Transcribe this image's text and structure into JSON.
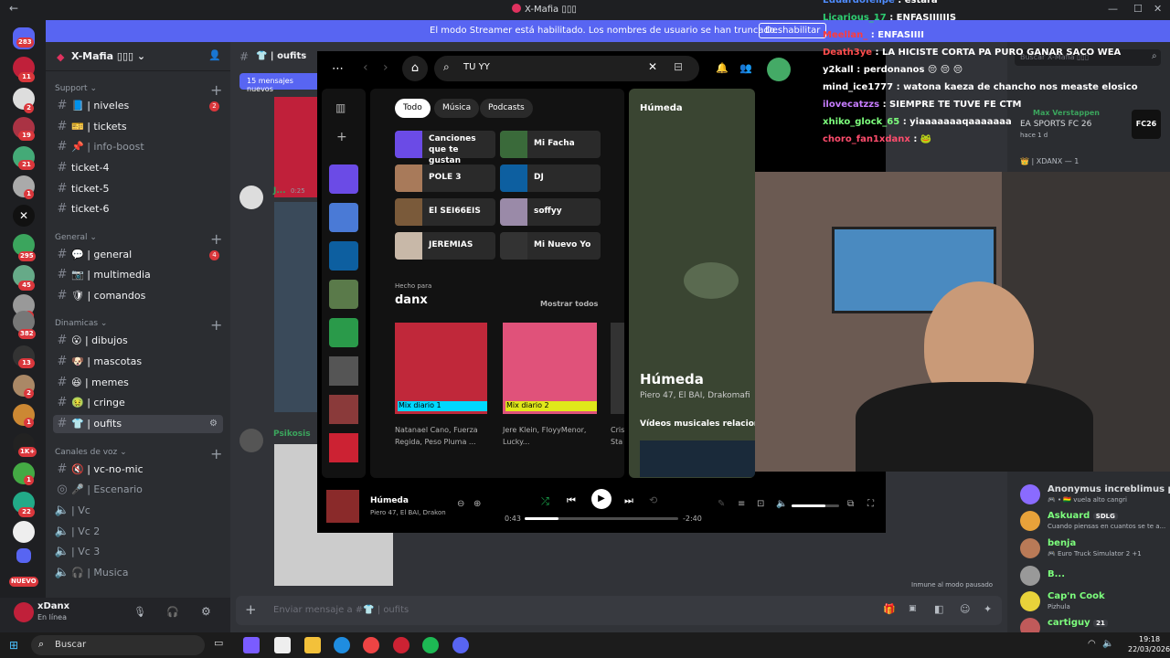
{
  "window": {
    "title": "X-Mafia ▯▯▯",
    "back": "←"
  },
  "banner": {
    "text": "El modo Streamer está habilitado. Los nombres de usuario se han truncado.",
    "button": "Deshabilitar"
  },
  "guilds": {
    "badges": [
      "283",
      "11",
      "2",
      "19",
      "21",
      "1",
      "295",
      "45",
      "1",
      "382",
      "13",
      "2",
      "1",
      "1K+",
      "1",
      "22",
      "NUEVO"
    ]
  },
  "server": {
    "name": "X-Mafia ▯▯▯ ⌄"
  },
  "categories": {
    "support": "Support ⌄",
    "general": "General ⌄",
    "dinamicas": "Dinamicas ⌄",
    "voz": "Canales de voz ⌄"
  },
  "channels": [
    {
      "label": "📘 | niveles",
      "badge": "2"
    },
    {
      "label": "🎫 | tickets",
      "badge": ""
    },
    {
      "label": "📌 | info-boost",
      "badge": ""
    },
    {
      "label": "ticket-4",
      "badge": ""
    },
    {
      "label": "ticket-5",
      "badge": ""
    },
    {
      "label": "ticket-6",
      "badge": ""
    },
    {
      "label": "💬 | general",
      "badge": "4"
    },
    {
      "label": "📷 | multimedia",
      "badge": ""
    },
    {
      "label": "🛡 | comandos",
      "badge": ""
    },
    {
      "label": "😮 | dibujos",
      "badge": ""
    },
    {
      "label": "🐶 | mascotas",
      "badge": ""
    },
    {
      "label": "😆 | memes",
      "badge": ""
    },
    {
      "label": "🤢 | cringe",
      "badge": ""
    },
    {
      "label": "👕 | oufits",
      "badge": ""
    }
  ],
  "voice": [
    "🔇 | vc-no-mic",
    "🎤 | Escenario",
    "| Vc",
    "| Vc 2",
    "| Vc 3",
    "🎧 | Musica"
  ],
  "user": {
    "name": "xDanx",
    "status": "En línea"
  },
  "chat": {
    "channel": "👕 | oufits",
    "new_messages": "15 mensajes nuevos",
    "msg_author1": "J...",
    "msg_time1": "0:25",
    "msg_author2": "Psikosis",
    "input_placeholder": "Enviar mensaje a #👕 | oufits",
    "paused": "Inmune al modo pausado"
  },
  "spotify": {
    "search": "TU YY",
    "chips": [
      "Todo",
      "Música",
      "Podcasts"
    ],
    "cards": [
      "Canciones que te gustan",
      "Mi Facha",
      "POLE 3",
      "DJ",
      "El SEI66EIS",
      "soffyy",
      "JEREMIAS",
      "Mi Nuevo Yo"
    ],
    "made_for": "Hecho para",
    "made_for_user": "danx",
    "show_all": "Mostrar todos",
    "mixes": [
      {
        "label": "Mix diario 1",
        "artists": "Natanael Cano, Fuerza Regida, Peso Pluma ..."
      },
      {
        "label": "Mix diario 2",
        "artists": "Jere Klein, FloyyMenor, Lucky..."
      }
    ],
    "mix3_artists": "Cris Sta",
    "now_header": "Húmeda",
    "now_title": "Húmeda",
    "now_artists": "Piero 47, El BAI, Drakomafi",
    "videos": "Vídeos musicales relacion",
    "bar_title": "Húmeda",
    "bar_artists": "Piero 47, El BAI, Drakon",
    "elapsed": "0:43",
    "remaining": "-2:40",
    "progress": 0.22,
    "volume": 0.72
  },
  "twitch_chat": [
    {
      "user": "Eduardofelipe",
      "msg": ": estara",
      "color": "#4f8cff"
    },
    {
      "user": "Licarious_17",
      "msg": ": ENFASIIIIIIS",
      "color": "#2ecc71"
    },
    {
      "user": "Meellan_",
      "msg": ": ENFASIIII",
      "color": "#ff3b3b"
    },
    {
      "user": "Death3ye",
      "msg": ": LA HICISTE CORTA PA PURO GANAR SACO WEA",
      "color": "#ff4d4d"
    },
    {
      "user": "y2kall",
      "msg": ": perdonanos 😔 😔 😔",
      "color": "#ffffff"
    },
    {
      "user": "mind_ice1777",
      "msg": ": watona kaeza de chancho nos measte elosico",
      "color": "#ffffff"
    },
    {
      "user": "ilovecatzzs",
      "msg": ": SIEMPRE TE TUVE FE CTM",
      "color": "#c77dff"
    },
    {
      "user": "xhiko_glock_65",
      "msg": ": yiaaaaaaaqaaaaaaa",
      "color": "#7dff7d"
    },
    {
      "user": "choro_fan1xdanx",
      "msg": ": 🐸",
      "color": "#ff4d6d"
    }
  ],
  "members": {
    "search": "Buscar X-Mafia ▯▯▯",
    "top": {
      "name": "Max Verstappen",
      "activity": "EA SPORTS FC 26",
      "time": "hace 1 d",
      "game_logo": "FC26"
    },
    "group": "👑 | XDANX — 1",
    "list": [
      {
        "name": "Anonymus increblimus pr...",
        "status": "🎮 • 🇧🇴 vuela alto cangri",
        "color": "#8a6bff"
      },
      {
        "name": "Askuard",
        "tag": "SDLG",
        "status": "Cuando piensas en cuantos se te a...",
        "color": "#e8a23a"
      },
      {
        "name": "benja",
        "status": "🎮 Euro Truck Simulator 2 +1",
        "color": "#b97a57"
      },
      {
        "name": "B...",
        "status": "",
        "color": "#999999"
      },
      {
        "name": "Cap'n Cook",
        "status": "Pizhula",
        "color": "#e8d23a"
      },
      {
        "name": "cartiguy",
        "tag": "21",
        "status": "",
        "color": "#c05a5a"
      }
    ]
  },
  "taskbar": {
    "search": "Buscar",
    "time": "19:18",
    "date": "22/03/2026"
  },
  "colors": {
    "discord_bg": "#313338",
    "spotify_green": "#1db954",
    "blurple": "#5865f2"
  }
}
